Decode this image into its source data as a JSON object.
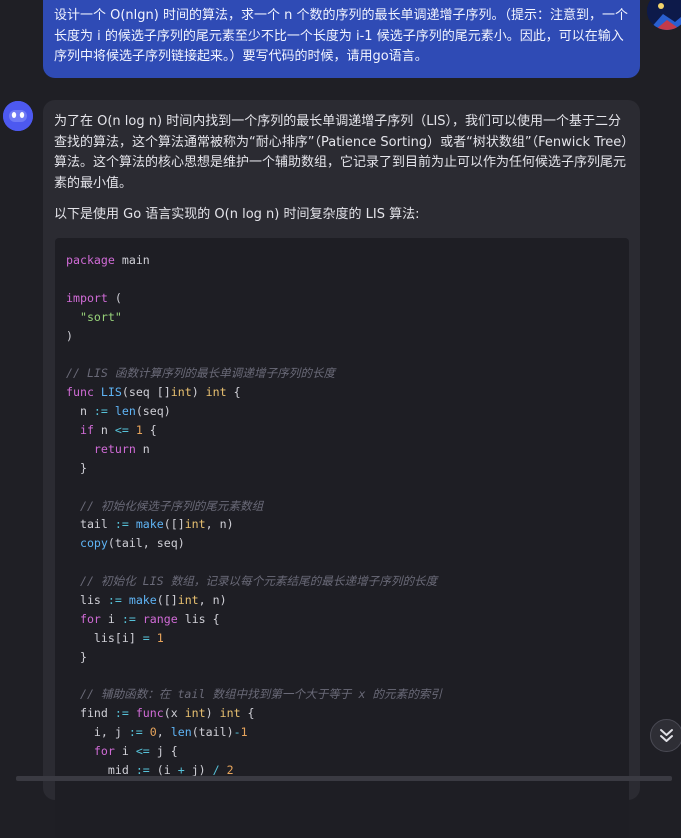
{
  "user_message": {
    "text": "设计一个 O(nlgn) 时间的算法，求一个 n 个数的序列的最长单调递增子序列。（提示：注意到，一个长度为 i 的候选子序列的尾元素至少不比一个长度为 i-1 候选子序列的尾元素小。因此，可以在输入序列中将候选子序列链接起来。）要写代码的时候，请用go语言。"
  },
  "assistant_message": {
    "paragraph1": "为了在 O(n log n) 时间内找到一个序列的最长单调递增子序列（LIS），我们可以使用一个基于二分查找的算法，这个算法通常被称为“耐心排序”（Patience Sorting）或者“树状数组”（Fenwick Tree）算法。这个算法的核心思想是维护一个辅助数组，它记录了到目前为止可以作为任何候选子序列尾元素的最小值。",
    "paragraph2": "以下是使用 Go 语言实现的 O(n log n) 时间复杂度的 LIS 算法:"
  },
  "code_lines": [
    [
      {
        "t": "kw",
        "v": "package"
      },
      {
        "t": "",
        "v": " main"
      }
    ],
    [],
    [
      {
        "t": "kw",
        "v": "import"
      },
      {
        "t": "",
        "v": " ("
      }
    ],
    [
      {
        "t": "",
        "v": "  "
      },
      {
        "t": "st",
        "v": "\"sort\""
      }
    ],
    [
      {
        "t": "",
        "v": ")"
      }
    ],
    [],
    [
      {
        "t": "cm",
        "v": "// LIS 函数计算序列的最长单调递增子序列的长度"
      }
    ],
    [
      {
        "t": "kw",
        "v": "func"
      },
      {
        "t": "",
        "v": " "
      },
      {
        "t": "fn",
        "v": "LIS"
      },
      {
        "t": "",
        "v": "(seq []"
      },
      {
        "t": "ty",
        "v": "int"
      },
      {
        "t": "",
        "v": ") "
      },
      {
        "t": "ty",
        "v": "int"
      },
      {
        "t": "",
        "v": " {"
      }
    ],
    [
      {
        "t": "",
        "v": "  n "
      },
      {
        "t": "op",
        "v": ":="
      },
      {
        "t": "",
        "v": " "
      },
      {
        "t": "fn",
        "v": "len"
      },
      {
        "t": "",
        "v": "(seq)"
      }
    ],
    [
      {
        "t": "",
        "v": "  "
      },
      {
        "t": "kw",
        "v": "if"
      },
      {
        "t": "",
        "v": " n "
      },
      {
        "t": "op",
        "v": "<="
      },
      {
        "t": "",
        "v": " "
      },
      {
        "t": "nu",
        "v": "1"
      },
      {
        "t": "",
        "v": " {"
      }
    ],
    [
      {
        "t": "",
        "v": "    "
      },
      {
        "t": "kw",
        "v": "return"
      },
      {
        "t": "",
        "v": " n"
      }
    ],
    [
      {
        "t": "",
        "v": "  }"
      }
    ],
    [],
    [
      {
        "t": "",
        "v": "  "
      },
      {
        "t": "cm",
        "v": "// 初始化候选子序列的尾元素数组"
      }
    ],
    [
      {
        "t": "",
        "v": "  tail "
      },
      {
        "t": "op",
        "v": ":="
      },
      {
        "t": "",
        "v": " "
      },
      {
        "t": "fn",
        "v": "make"
      },
      {
        "t": "",
        "v": "([]"
      },
      {
        "t": "ty",
        "v": "int"
      },
      {
        "t": "",
        "v": ", n)"
      }
    ],
    [
      {
        "t": "",
        "v": "  "
      },
      {
        "t": "fn",
        "v": "copy"
      },
      {
        "t": "",
        "v": "(tail, seq)"
      }
    ],
    [],
    [
      {
        "t": "",
        "v": "  "
      },
      {
        "t": "cm",
        "v": "// 初始化 LIS 数组，记录以每个元素结尾的最长递增子序列的长度"
      }
    ],
    [
      {
        "t": "",
        "v": "  lis "
      },
      {
        "t": "op",
        "v": ":="
      },
      {
        "t": "",
        "v": " "
      },
      {
        "t": "fn",
        "v": "make"
      },
      {
        "t": "",
        "v": "([]"
      },
      {
        "t": "ty",
        "v": "int"
      },
      {
        "t": "",
        "v": ", n)"
      }
    ],
    [
      {
        "t": "",
        "v": "  "
      },
      {
        "t": "kw",
        "v": "for"
      },
      {
        "t": "",
        "v": " i "
      },
      {
        "t": "op",
        "v": ":="
      },
      {
        "t": "",
        "v": " "
      },
      {
        "t": "kw",
        "v": "range"
      },
      {
        "t": "",
        "v": " lis {"
      }
    ],
    [
      {
        "t": "",
        "v": "    lis[i] "
      },
      {
        "t": "op",
        "v": "="
      },
      {
        "t": "",
        "v": " "
      },
      {
        "t": "nu",
        "v": "1"
      }
    ],
    [
      {
        "t": "",
        "v": "  }"
      }
    ],
    [],
    [
      {
        "t": "",
        "v": "  "
      },
      {
        "t": "cm",
        "v": "// 辅助函数：在 tail 数组中找到第一个大于等于 x 的元素的索引"
      }
    ],
    [
      {
        "t": "",
        "v": "  find "
      },
      {
        "t": "op",
        "v": ":="
      },
      {
        "t": "",
        "v": " "
      },
      {
        "t": "kw",
        "v": "func"
      },
      {
        "t": "",
        "v": "(x "
      },
      {
        "t": "ty",
        "v": "int"
      },
      {
        "t": "",
        "v": ") "
      },
      {
        "t": "ty",
        "v": "int"
      },
      {
        "t": "",
        "v": " {"
      }
    ],
    [
      {
        "t": "",
        "v": "    i, j "
      },
      {
        "t": "op",
        "v": ":="
      },
      {
        "t": "",
        "v": " "
      },
      {
        "t": "nu",
        "v": "0"
      },
      {
        "t": "",
        "v": ", "
      },
      {
        "t": "fn",
        "v": "len"
      },
      {
        "t": "",
        "v": "(tail)"
      },
      {
        "t": "op",
        "v": "-"
      },
      {
        "t": "nu",
        "v": "1"
      }
    ],
    [
      {
        "t": "",
        "v": "    "
      },
      {
        "t": "kw",
        "v": "for"
      },
      {
        "t": "",
        "v": " i "
      },
      {
        "t": "op",
        "v": "<="
      },
      {
        "t": "",
        "v": " j {"
      }
    ],
    [
      {
        "t": "",
        "v": "      mid "
      },
      {
        "t": "op",
        "v": ":="
      },
      {
        "t": "",
        "v": " (i "
      },
      {
        "t": "op",
        "v": "+"
      },
      {
        "t": "",
        "v": " j) "
      },
      {
        "t": "op",
        "v": "/"
      },
      {
        "t": "",
        "v": " "
      },
      {
        "t": "nu",
        "v": "2"
      }
    ]
  ],
  "icons": {
    "assistant_avatar": "robot-face-icon",
    "user_avatar": "user-avatar-icon",
    "scroll_down": "double-chevron-down-icon"
  },
  "colors": {
    "user_bubble": "#2f4bb5",
    "assistant_card": "#2b2b32",
    "code_bg": "#1e1e24",
    "keyword": "#d06bd6",
    "type": "#e8c070",
    "function": "#5fb4f5",
    "string": "#98d37a",
    "number": "#e8a55c",
    "comment": "#6a6a78"
  }
}
